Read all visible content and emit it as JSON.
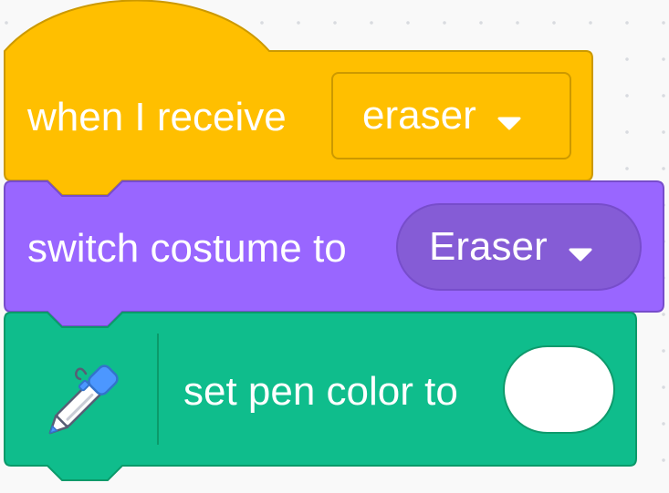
{
  "event_block": {
    "label": "when I receive",
    "message": "eraser",
    "color": "#ffbf00"
  },
  "looks_block": {
    "label": "switch costume to",
    "costume": "Eraser",
    "color": "#9966ff"
  },
  "pen_block": {
    "icon": "pen-icon",
    "label": "set pen color to",
    "color_value": "#ffffff",
    "color": "#0fbd8c"
  }
}
